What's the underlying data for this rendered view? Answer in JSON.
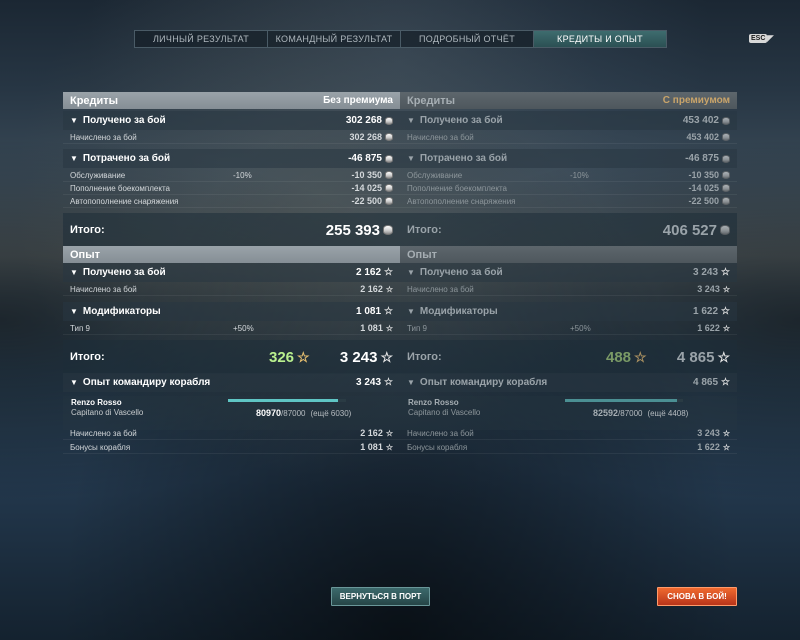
{
  "tabs": [
    {
      "label": "ЛИЧНЫЙ РЕЗУЛЬТАТ"
    },
    {
      "label": "КОМАНДНЫЙ РЕЗУЛЬТАТ"
    },
    {
      "label": "ПОДРОБНЫЙ ОТЧЁТ"
    },
    {
      "label": "КРЕДИТЫ И ОПЫТ",
      "active": true
    }
  ],
  "esc_label": "ESC",
  "labels": {
    "credits": "Кредиты",
    "earned": "Получено за бой",
    "accrued": "Начислено за бой",
    "spent": "Потрачено за бой",
    "service": "Обслуживание",
    "ammo": "Пополнение боекомплекта",
    "equipment": "Автопополнение снаряжения",
    "total": "Итого:",
    "xp": "Опыт",
    "modifiers": "Модификаторы",
    "tier": "Тип 9",
    "commander_xp": "Опыт командиру корабля",
    "ship_bonus": "Бонусы корабля"
  },
  "left": {
    "header_right": "Без премиума",
    "credits_earned": "302 268",
    "credits_accrued": "302 268",
    "spent_total": "-46 875",
    "service_pct": "-10%",
    "service": "-10 350",
    "ammo": "-14 025",
    "equipment": "-22 500",
    "credits_total": "255 393",
    "xp_earned": "2 162",
    "xp_accrued": "2 162",
    "modifiers": "1 081",
    "tier_pct": "+50%",
    "tier_value": "1 081",
    "xp_base": "326",
    "xp_total": "3 243",
    "commander_xp": "3 243",
    "commander_name": "Renzo Rosso",
    "commander_rank": "Capitano di Vascello",
    "commander_xp_current": "80970",
    "commander_xp_max": "/87000",
    "commander_xp_remaining": "(ещё 6030)",
    "commander_progress": 0.93,
    "cmd_accrued": "2 162",
    "cmd_bonus": "1 081"
  },
  "right": {
    "header_right": "С премиумом",
    "credits_earned": "453 402",
    "credits_accrued": "453 402",
    "spent_total": "-46 875",
    "service_pct": "-10%",
    "service": "-10 350",
    "ammo": "-14 025",
    "equipment": "-22 500",
    "credits_total": "406 527",
    "xp_earned": "3 243",
    "xp_accrued": "3 243",
    "modifiers": "1 622",
    "tier_pct": "+50%",
    "tier_value": "1 622",
    "xp_base": "488",
    "xp_total": "4 865",
    "commander_xp": "4 865",
    "commander_name": "Renzo Rosso",
    "commander_rank": "Capitano di Vascello",
    "commander_xp_current": "82592",
    "commander_xp_max": "/87000",
    "commander_xp_remaining": "(ещё 4408)",
    "commander_progress": 0.95,
    "cmd_accrued": "3 243",
    "cmd_bonus": "1 622"
  },
  "buttons": {
    "port": "ВЕРНУТЬСЯ В ПОРТ",
    "battle": "СНОВА В БОЙ!"
  },
  "colors": {
    "accent_tab": "#3e6c6f",
    "battle_button": "#e04e22",
    "xp_base": "#b9f08e",
    "premium_label": "#c9a46a"
  },
  "icons": {
    "credit": "credit-coin-icon",
    "xp": "star-icon",
    "collapse": "triangle-down-icon"
  }
}
